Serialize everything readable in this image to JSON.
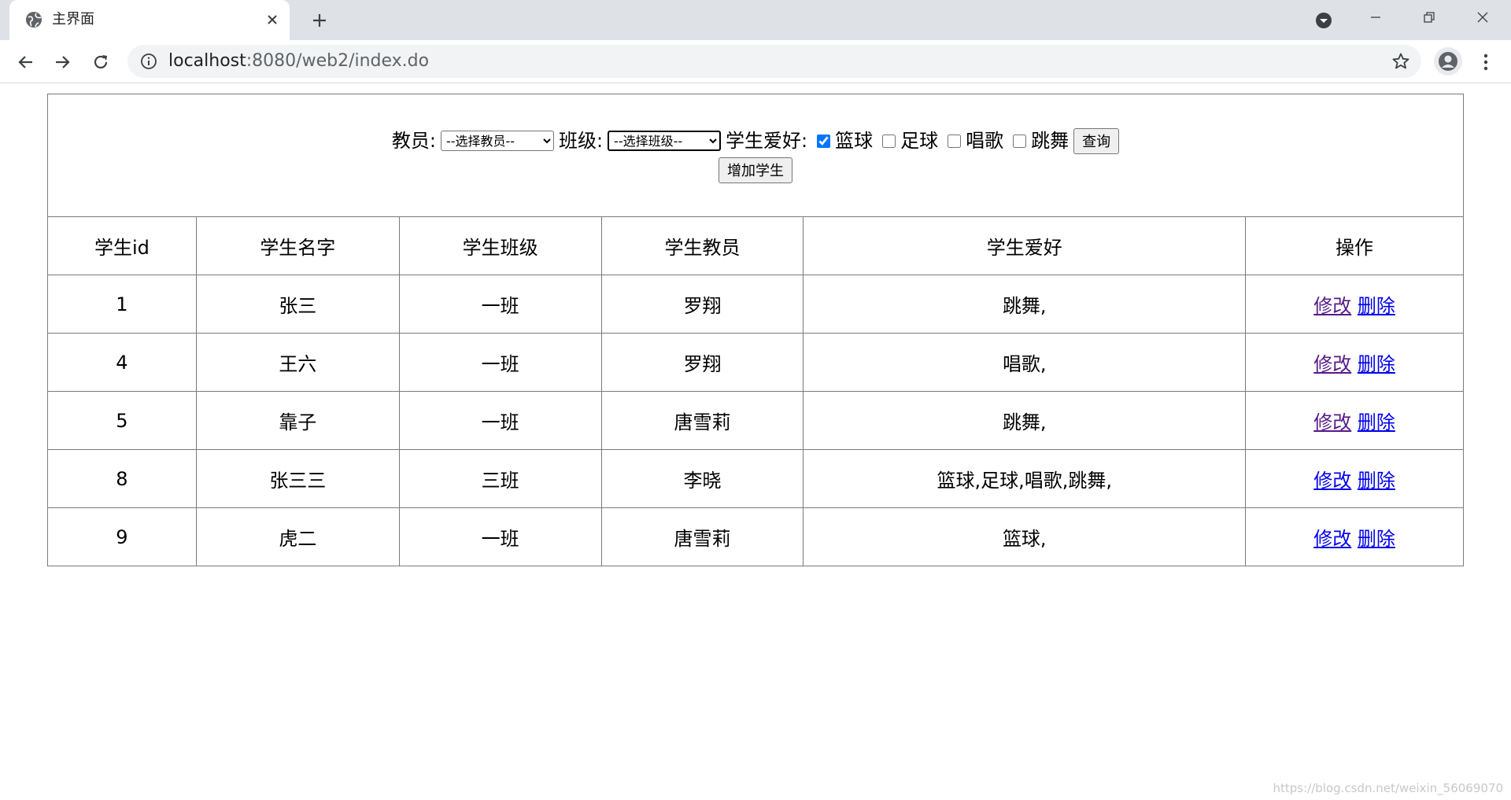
{
  "browser": {
    "tab_title": "主界面",
    "url_host": "localhost",
    "url_rest": ":8080/web2/index.do",
    "icons": {
      "favicon": "globe-icon",
      "tab_close": "close-icon",
      "new_tab": "plus-icon",
      "tab_search": "chevron-down-icon",
      "back": "back-arrow-icon",
      "forward": "forward-arrow-icon",
      "reload": "reload-icon",
      "site_info": "info-icon",
      "bookmark": "star-icon",
      "profile": "person-icon",
      "menu": "kebab-menu-icon"
    }
  },
  "filter": {
    "teacher_label": "教员:",
    "teacher_selected": "--选择教员--",
    "class_label": "班级:",
    "class_selected": "--选择班级--",
    "hobby_label": "学生爱好:",
    "hobbies": [
      {
        "label": "篮球",
        "checked": true
      },
      {
        "label": "足球",
        "checked": false
      },
      {
        "label": "唱歌",
        "checked": false
      },
      {
        "label": "跳舞",
        "checked": false
      }
    ],
    "query_button": "查询",
    "add_button": "增加学生"
  },
  "table": {
    "headers": [
      "学生id",
      "学生名字",
      "学生班级",
      "学生教员",
      "学生爱好",
      "操作"
    ],
    "rows": [
      {
        "id": "1",
        "name": "张三",
        "class": "一班",
        "teacher": "罗翔",
        "hobby": "跳舞,"
      },
      {
        "id": "4",
        "name": "王六",
        "class": "一班",
        "teacher": "罗翔",
        "hobby": "唱歌,"
      },
      {
        "id": "5",
        "name": "靠子",
        "class": "一班",
        "teacher": "唐雪莉",
        "hobby": "跳舞,"
      },
      {
        "id": "8",
        "name": "张三三",
        "class": "三班",
        "teacher": "李晓",
        "hobby": "篮球,足球,唱歌,跳舞,"
      },
      {
        "id": "9",
        "name": "虎二",
        "class": "一班",
        "teacher": "唐雪莉",
        "hobby": "篮球,"
      }
    ],
    "edit_label": "修改",
    "delete_label": "删除"
  },
  "watermark": "https://blog.csdn.net/weixin_56069070",
  "colors": {
    "link": "#0000ee",
    "visited_link": "#551a8b",
    "tabstrip": "#dee1e6",
    "omnibox": "#f1f3f4"
  }
}
